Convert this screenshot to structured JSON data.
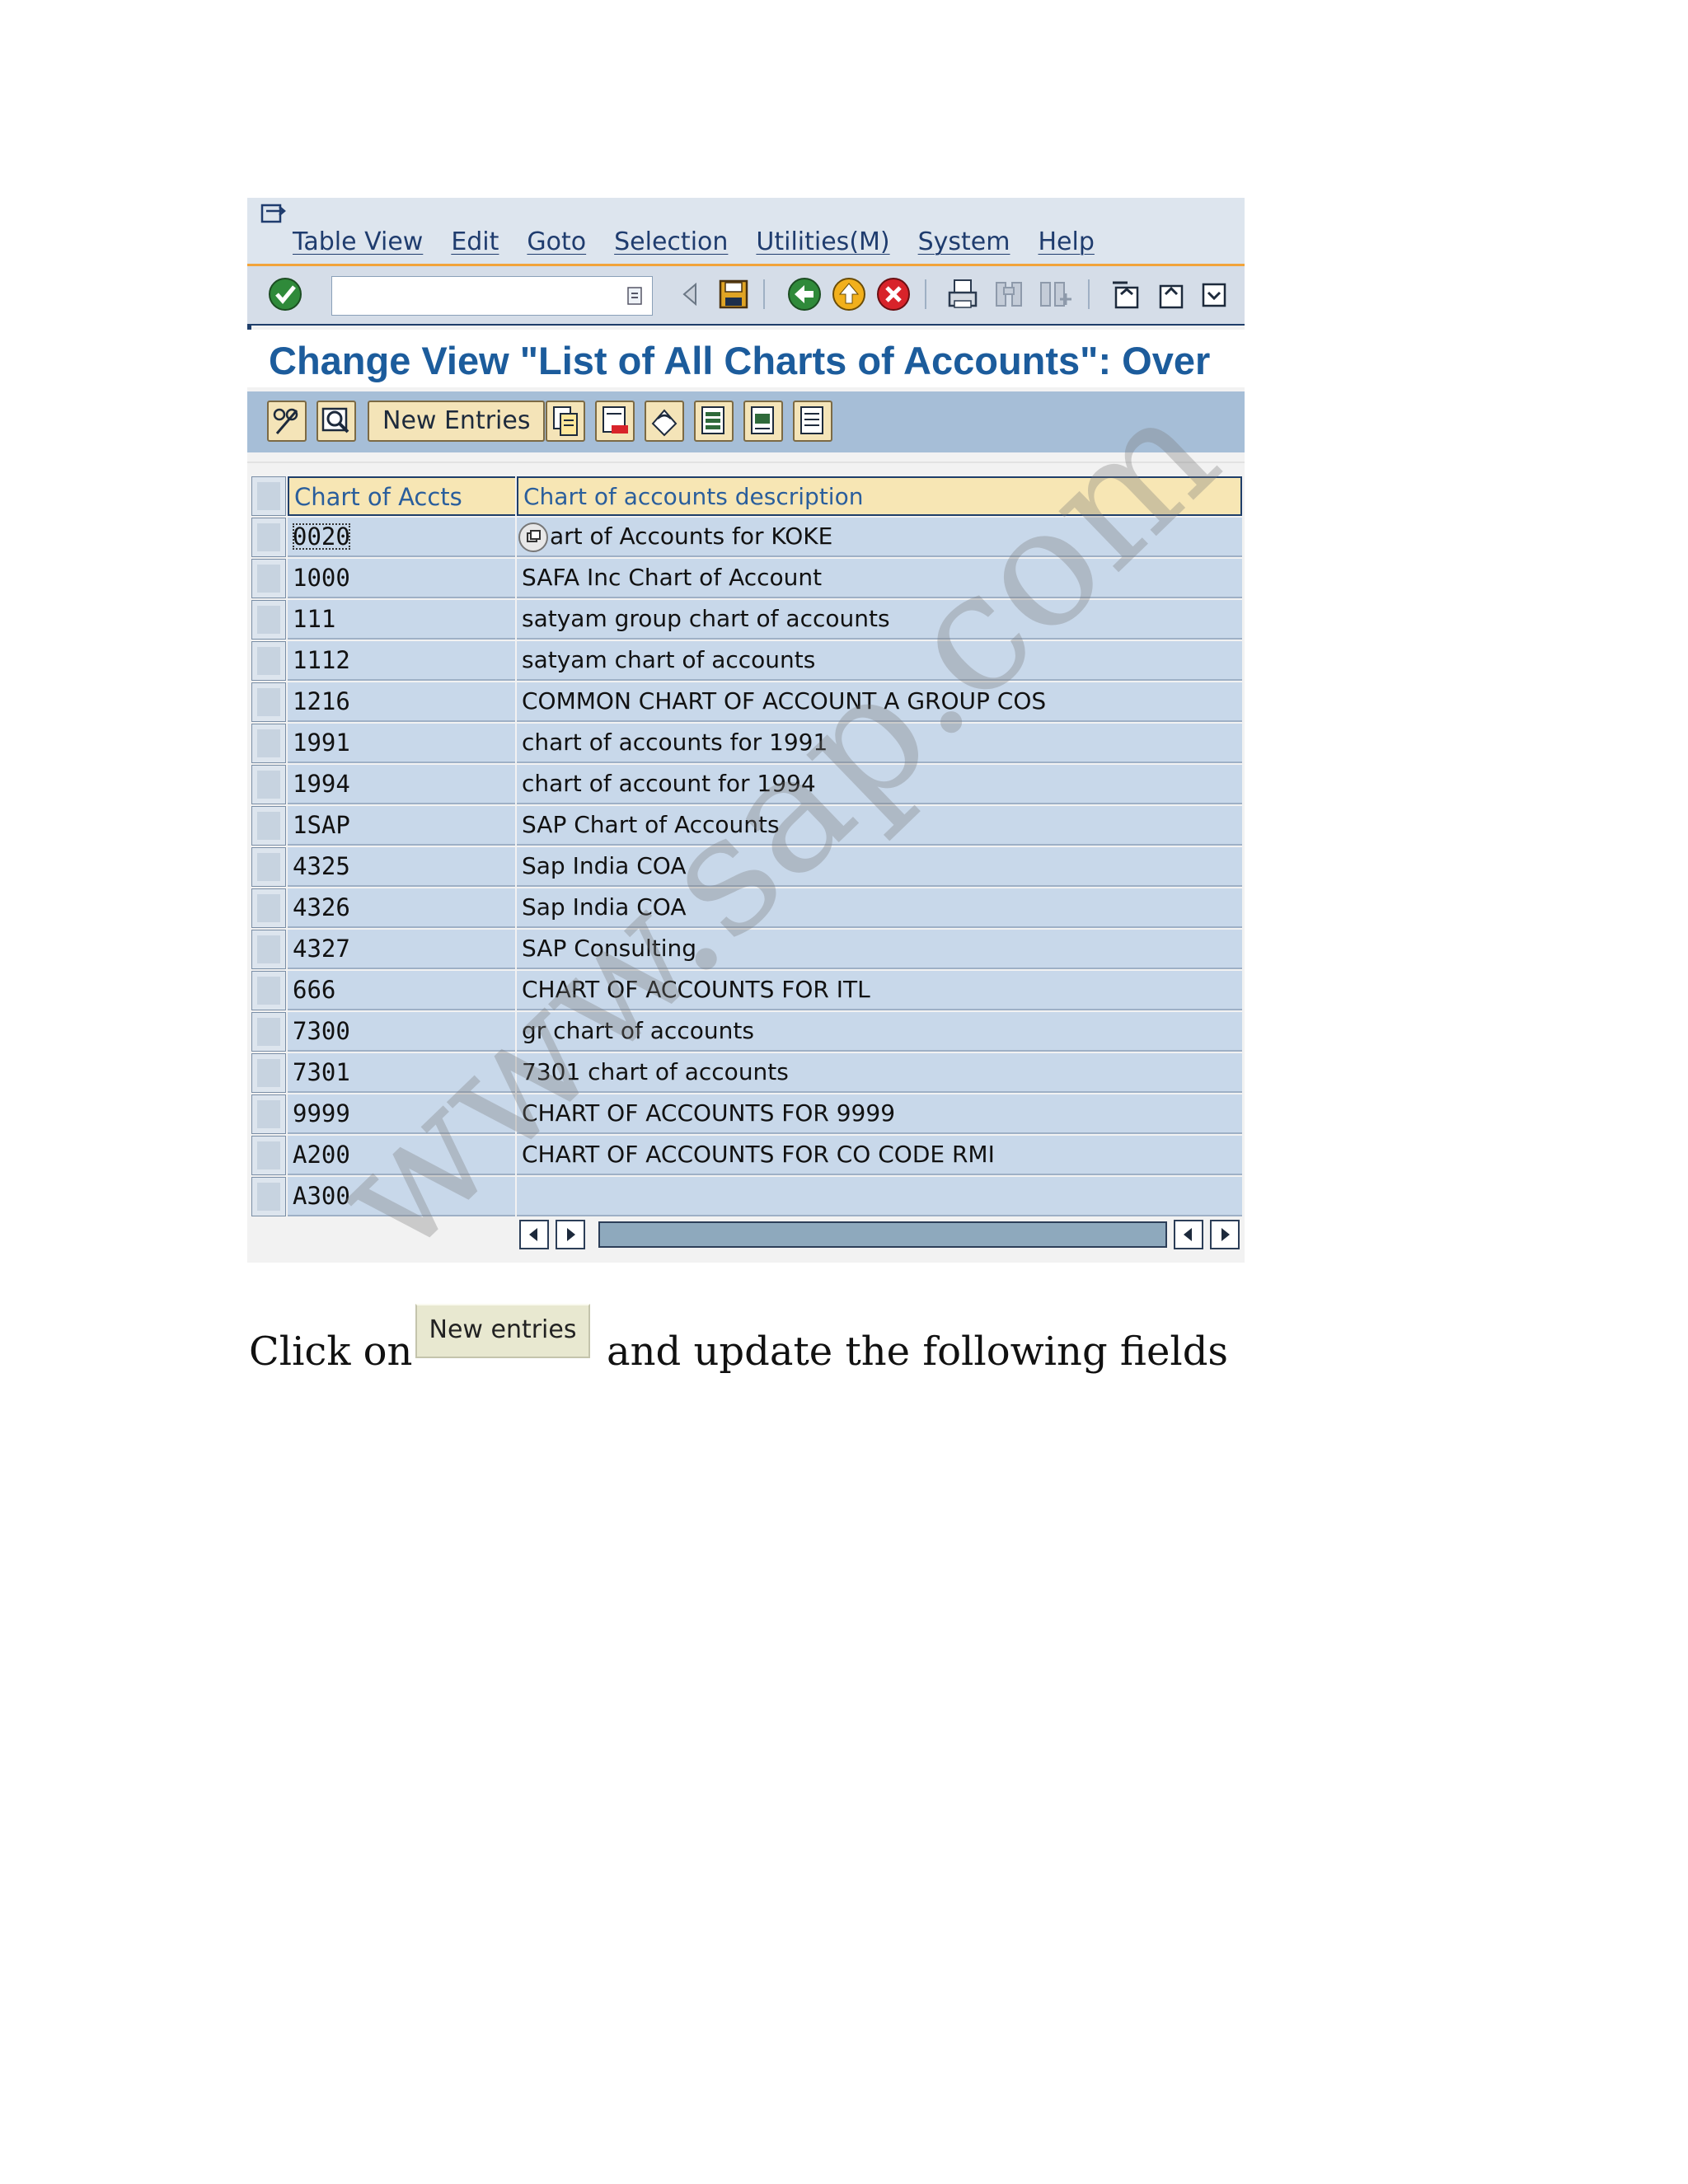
{
  "menubar": {
    "items": [
      "Table View",
      "Edit",
      "Goto",
      "Selection",
      "Utilities(M)",
      "System",
      "Help"
    ]
  },
  "title": "Change View \"List of All Charts of Accounts\": Over",
  "app_toolbar": {
    "new_entries_label": "New Entries"
  },
  "table": {
    "headers": [
      "Chart of Accts",
      "Chart of accounts description"
    ],
    "rows": [
      {
        "code": "0020",
        "desc": "art of Accounts for KOKE"
      },
      {
        "code": "1000",
        "desc": "SAFA Inc Chart of Account"
      },
      {
        "code": "111",
        "desc": "satyam group chart of accounts"
      },
      {
        "code": "1112",
        "desc": "satyam chart of accounts"
      },
      {
        "code": "1216",
        "desc": "COMMON CHART OF ACCOUNT A GROUP COS"
      },
      {
        "code": "1991",
        "desc": "chart of accounts for 1991"
      },
      {
        "code": "1994",
        "desc": "chart of account for 1994"
      },
      {
        "code": "1SAP",
        "desc": "SAP Chart of Accounts"
      },
      {
        "code": "4325",
        "desc": "Sap India COA"
      },
      {
        "code": "4326",
        "desc": "Sap India COA"
      },
      {
        "code": "4327",
        "desc": "SAP Consulting"
      },
      {
        "code": "666",
        "desc": "CHART OF ACCOUNTS FOR ITL"
      },
      {
        "code": "7300",
        "desc": "gr chart of accounts"
      },
      {
        "code": "7301",
        "desc": "7301 chart of accounts"
      },
      {
        "code": "9999",
        "desc": "CHART OF ACCOUNTS FOR 9999"
      },
      {
        "code": "A200",
        "desc": "CHART OF ACCOUNTS FOR CO  CODE RMI"
      },
      {
        "code": "A300",
        "desc": ""
      }
    ]
  },
  "caption": {
    "before": "Click on",
    "button_label": "New entries",
    "after": "and update the following fields"
  },
  "watermark": "www.sap",
  "watermark_tail": ".com"
}
